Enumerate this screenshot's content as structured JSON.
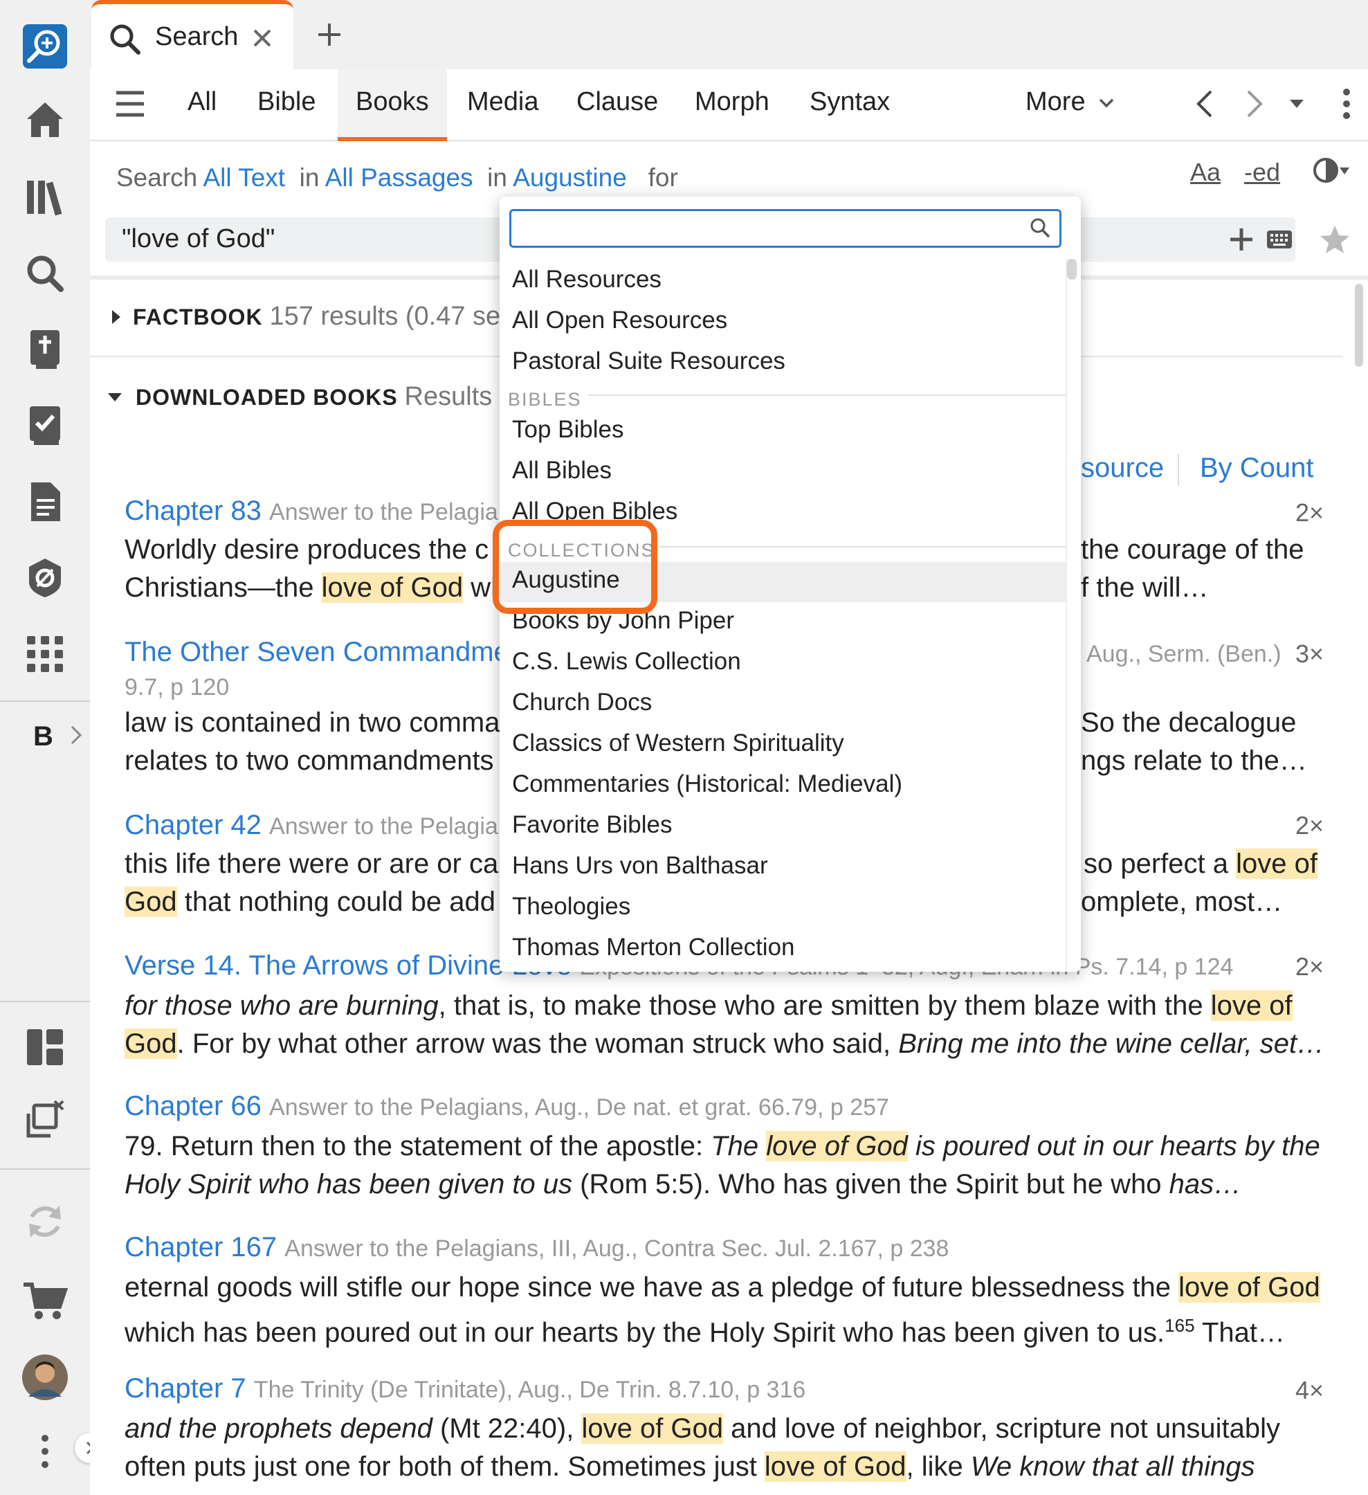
{
  "tab": {
    "label": "Search"
  },
  "nav_tabs": [
    "All",
    "Bible",
    "Books",
    "Media",
    "Clause",
    "Morph",
    "Syntax"
  ],
  "nav_more": "More",
  "config": {
    "prefix": "Search",
    "scope_text": "All Text",
    "in1": "in",
    "scope_passages": "All Passages",
    "in2": "in",
    "scope_collection": "Augustine",
    "for": "for"
  },
  "tools": {
    "case": "Aa",
    "ed": "-ed"
  },
  "query": "\"love of God\"",
  "rail": {
    "b_label": "B"
  },
  "sections": {
    "factbook": {
      "label": "FACTBOOK",
      "meta": "157 results (0.47 se"
    },
    "downloaded": {
      "label": "DOWNLOADED BOOKS",
      "meta": "Results 1"
    }
  },
  "sort": {
    "by_source": "source",
    "by_count": "By Count"
  },
  "results": [
    {
      "title": "Chapter 83",
      "source": "Answer to the Pelagiar",
      "count": "2×",
      "l1a": "Worldly desire produces the c",
      "l1b": "the courage of the",
      "l2a": "Christians—the ",
      "l2hl": "love of God",
      "l2b": " wl",
      "l2c": "f the will…"
    },
    {
      "title": "The Other Seven Commandme",
      "source_right": "Aug., Serm. (Ben.)",
      "sub": "9.7, p 120",
      "count": "3×",
      "l1a": "law is contained in two comma",
      "l1b": "So the decalogue",
      "l2a": "relates to two commandments",
      "l2b": "ngs relate to the…"
    },
    {
      "title": "Chapter 42",
      "source": "Answer to the Pelagiar",
      "count": "2×",
      "l1a": "this life there were or are or ca",
      "l1b": "so perfect a ",
      "l1hl": "love of",
      "l2hl": "God",
      "l2a": " that nothing could be add",
      "l2b": "omplete, most…"
    },
    {
      "title": "Verse 14. The Arrows of Divine Love",
      "source": "Expositions of the Psalms 1–32, Aug., Enarr. in Ps. 7.14, p 124",
      "count": "2×",
      "l1i": "for those who are burning",
      "l1a": ", that is, to make those who are smitten by them blaze with the ",
      "l1hl": "love of",
      "l2hl": "God",
      "l2a": ". For by what other arrow was the woman struck who said, ",
      "l2i": "Bring me into the wine cellar, set…"
    },
    {
      "title": "Chapter 66",
      "source": "Answer to the Pelagians, Aug., De nat. et grat. 66.79, p 257",
      "l1a": "79. Return then to the statement of the apostle: ",
      "l1i1": "The ",
      "l1hl": "love of God",
      "l1i2": " is poured out in our hearts by the",
      "l2i": "Holy Spirit who has been given to us",
      "l2a": " (Rom 5:5). Who has given the Spirit but he who ",
      "l2i2": "has…"
    },
    {
      "title": "Chapter 167",
      "source": "Answer to the Pelagians, III, Aug., Contra Sec. Jul. 2.167, p 238",
      "l1a": "eternal goods will stifle our hope since we have as a pledge of future blessedness the ",
      "l1hl": "love of God",
      "l2a": "which has been poured out in our hearts by the Holy Spirit who has been given to us.",
      "l2sup": "165",
      "l2b": " That…"
    },
    {
      "title": "Chapter 7",
      "source": "The Trinity (De Trinitate), Aug., De Trin. 8.7.10, p 316",
      "count": "4×",
      "l1i": "and the prophets depend",
      "l1a": " (Mt 22:40), ",
      "l1hl": "love of God",
      "l1b": " and love of neighbor, scripture not unsuitably",
      "l2a": "often puts just one for both of them. Sometimes just ",
      "l2hl": "love of God",
      "l2b": ", like ",
      "l2i": "We know that all things"
    }
  ],
  "dropdown": {
    "search_placeholder": "",
    "top": [
      "All Resources",
      "All Open Resources",
      "Pastoral Suite Resources"
    ],
    "bibles_header": "BIBLES",
    "bibles": [
      "Top Bibles",
      "All Bibles",
      "All Open Bibles"
    ],
    "collections_header": "COLLECTIONS",
    "collections": [
      "Augustine",
      "Books by John Piper",
      "C.S. Lewis Collection",
      "Church Docs",
      "Classics of Western Spirituality",
      "Commentaries (Historical: Medieval)",
      "Favorite Bibles",
      "Hans Urs von Balthasar",
      "Theologies",
      "Thomas Merton Collection"
    ],
    "selected": "Augustine"
  },
  "colors": {
    "accent": "#f26b1d",
    "link": "#2a7bd4",
    "highlight": "#fde9b2"
  },
  "icons": [
    "logos-search-icon",
    "home-icon",
    "library-icon",
    "search-icon",
    "bible-icon",
    "checklist-icon",
    "document-icon",
    "gear-shield-icon",
    "apps-grid-icon",
    "layouts-icon",
    "close-panels-icon",
    "sync-icon",
    "cart-icon",
    "avatar",
    "more-vertical-icon"
  ]
}
